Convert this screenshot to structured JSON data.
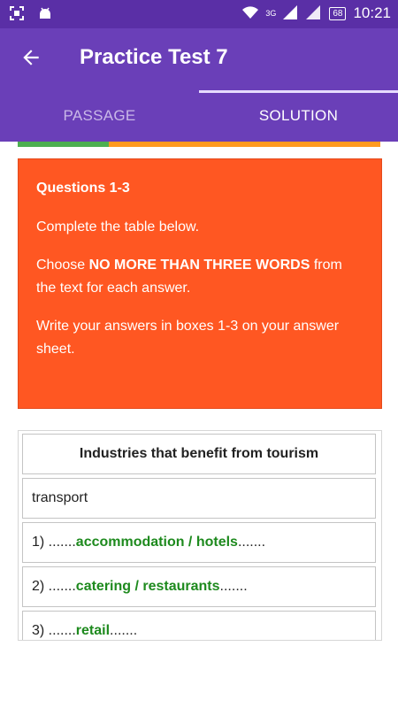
{
  "status": {
    "network": "3G",
    "battery": "68",
    "time": "10:21"
  },
  "appbar": {
    "title": "Practice Test 7",
    "back_icon": "arrow-left-icon"
  },
  "tabs": [
    {
      "label": "PASSAGE",
      "active": false
    },
    {
      "label": "SOLUTION",
      "active": true
    }
  ],
  "progress": {
    "fraction": 0.25,
    "done_color": "#4caf50",
    "remaining_color": "#ff9a1f"
  },
  "instructions": {
    "title": "Questions 1-3",
    "line1": "Complete the table below.",
    "line2_pre": "Choose ",
    "line2_bold": "NO MORE THAN THREE WORDS",
    "line2_post": " from the text for each answer.",
    "line3": "Write your answers in boxes 1-3 on your answer sheet.",
    "bg_color": "#ff5722"
  },
  "table": {
    "header": "Industries that benefit from tourism",
    "row1": "transport",
    "rows": [
      {
        "pre": "1) .......",
        "answer": "accommodation / hotels",
        "post": "......."
      },
      {
        "pre": "2) .......",
        "answer": "catering / restaurants",
        "post": "......."
      },
      {
        "pre": "3) .......",
        "answer": "retail",
        "post": "......."
      }
    ],
    "answer_color": "#1e8a1e"
  }
}
